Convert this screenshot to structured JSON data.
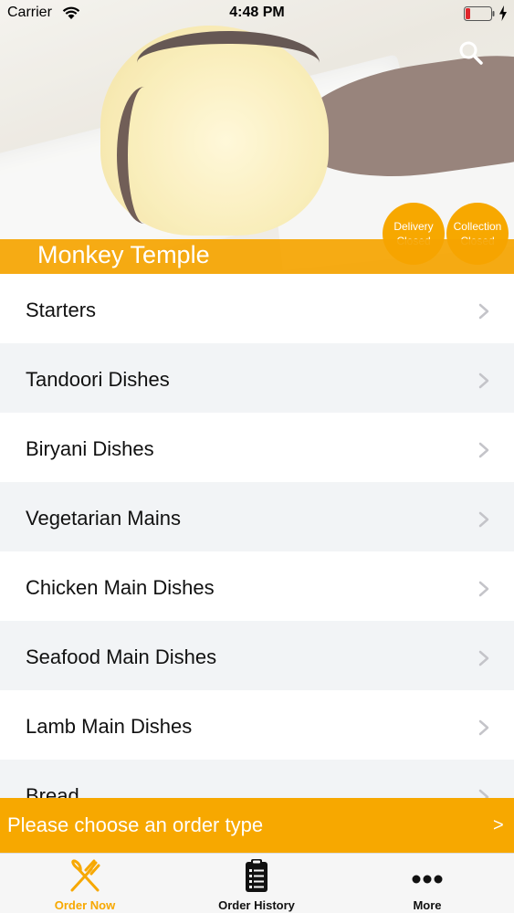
{
  "status_bar": {
    "carrier": "Carrier",
    "time": "4:48 PM",
    "icons": [
      "wifi-icon",
      "battery-icon",
      "charging-bolt-icon"
    ]
  },
  "header": {
    "restaurant_name": "Monkey Temple",
    "search_icon": "search-icon",
    "badges": {
      "delivery": {
        "line1": "Delivery",
        "line2": "Closed"
      },
      "collection": {
        "line1": "Collection",
        "line2": "Closed"
      }
    }
  },
  "menu": {
    "categories": [
      "Starters",
      "Tandoori Dishes",
      "Biryani Dishes",
      "Vegetarian Mains",
      "Chicken Main Dishes",
      "Seafood Main Dishes",
      "Lamb Main Dishes",
      "Bread"
    ]
  },
  "order_bar": {
    "text": "Please choose an order type",
    "arrow": ">"
  },
  "tab_bar": {
    "tabs": [
      {
        "label": "Order Now",
        "icon": "fork-knife-icon",
        "active": true
      },
      {
        "label": "Order History",
        "icon": "clipboard-list-icon",
        "active": false
      },
      {
        "label": "More",
        "icon": "more-dots-icon",
        "active": false
      }
    ]
  },
  "colors": {
    "accent": "#f7a800",
    "row_alt": "#f2f4f6",
    "tab_bar_bg": "#f6f6f6"
  }
}
